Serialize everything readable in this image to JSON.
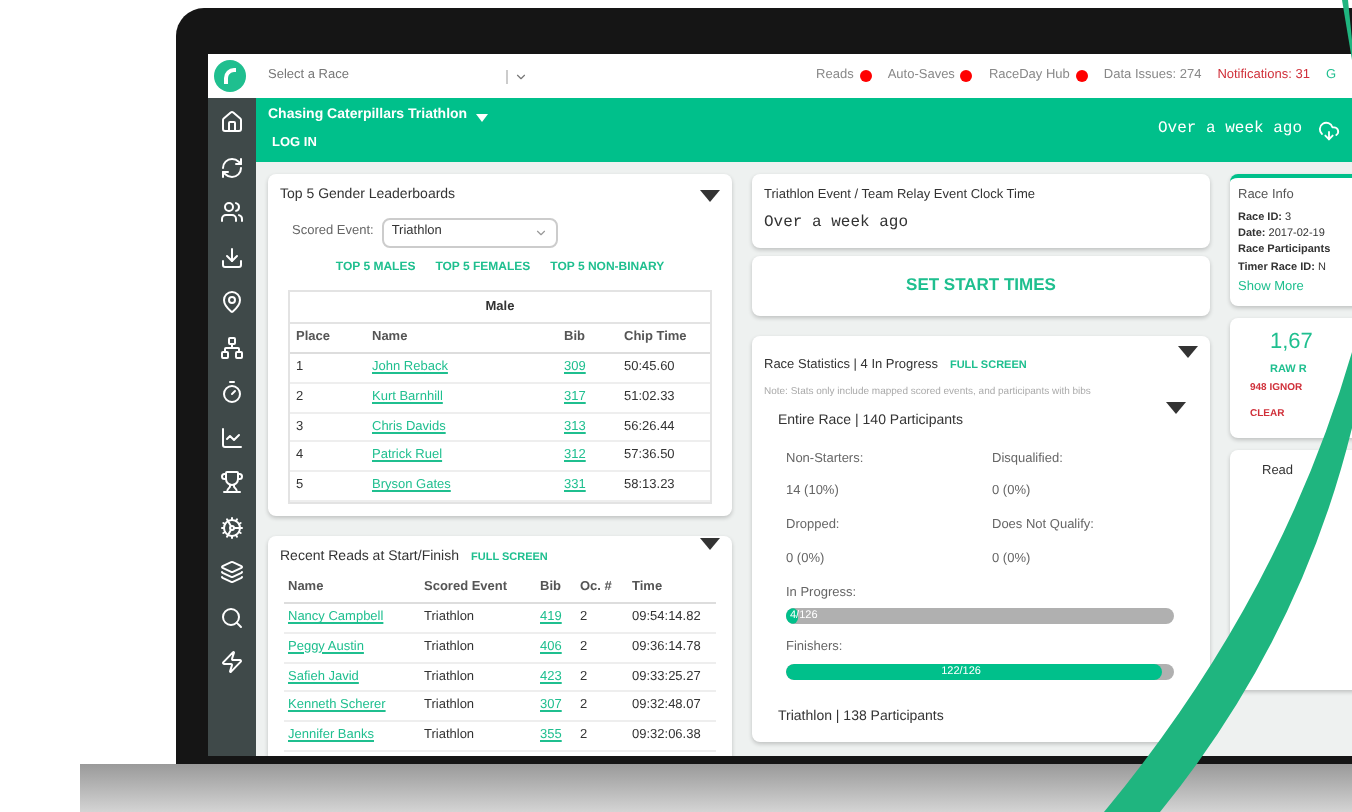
{
  "topbar": {
    "race_select": {
      "placeholder": "Select a Race"
    },
    "statuses": [
      {
        "label": "Reads",
        "color": "#ff0000"
      },
      {
        "label": "Auto-Saves",
        "color": "#ff0000"
      },
      {
        "label": "RaceDay Hub",
        "color": "#ff0000"
      }
    ],
    "data_issues": "Data Issues: 274",
    "notifications": "Notifications: 31",
    "cut_item": "G"
  },
  "header": {
    "race_name": "Chasing Caterpillars Triathlon",
    "login": "LOG IN",
    "updated": "Over a week ago"
  },
  "leaderboards": {
    "title": "Top 5 Gender Leaderboards",
    "scored_event_label": "Scored Event:",
    "scored_event": "Triathlon",
    "links": [
      "TOP 5 MALES",
      "TOP 5 FEMALES",
      "TOP 5 NON-BINARY"
    ],
    "table_title": "Male",
    "columns": [
      "Place",
      "Name",
      "Bib",
      "Chip Time"
    ],
    "rows": [
      [
        "1",
        "John Reback",
        "309",
        "50:45.60"
      ],
      [
        "2",
        "Kurt Barnhill",
        "317",
        "51:02.33"
      ],
      [
        "3",
        "Chris Davids",
        "313",
        "56:26.44"
      ],
      [
        "4",
        "Patrick Ruel",
        "312",
        "57:36.50"
      ],
      [
        "5",
        "Bryson Gates",
        "331",
        "58:13.23"
      ]
    ]
  },
  "recent_reads": {
    "title": "Recent Reads at Start/Finish",
    "full_screen": "FULL SCREEN",
    "columns": [
      "Name",
      "Scored Event",
      "Bib",
      "Oc. #",
      "Time"
    ],
    "rows": [
      [
        "Nancy Campbell",
        "Triathlon",
        "419",
        "2",
        "09:54:14.82"
      ],
      [
        "Peggy Austin",
        "Triathlon",
        "406",
        "2",
        "09:36:14.78"
      ],
      [
        "Safieh Javid",
        "Triathlon",
        "423",
        "2",
        "09:33:25.27"
      ],
      [
        "Kenneth Scherer",
        "Triathlon",
        "307",
        "2",
        "09:32:48.07"
      ],
      [
        "Jennifer Banks",
        "Triathlon",
        "355",
        "2",
        "09:32:06.38"
      ]
    ]
  },
  "clock": {
    "title": "Triathlon Event / Team Relay Event Clock Time",
    "value": "Over a week ago"
  },
  "set_start_times": "SET START TIMES",
  "race_stats": {
    "title": "Race Statistics | 4 In Progress",
    "full_screen": "FULL SCREEN",
    "note": "Note: Stats only include mapped scored events, and participants with bibs",
    "section": "Entire Race | 140 Participants",
    "stats": [
      {
        "label": "Non-Starters:",
        "value": "14 (10%)"
      },
      {
        "label": "Disqualified:",
        "value": "0 (0%)"
      },
      {
        "label": "Dropped:",
        "value": "0 (0%)"
      },
      {
        "label": "Does Not Qualify:",
        "value": "0 (0%)"
      }
    ],
    "bars": [
      {
        "label": "In Progress:",
        "reading": "4/126",
        "level": 0.032
      },
      {
        "label": "Finishers:",
        "reading": "122/126",
        "level": 0.968
      }
    ],
    "next_section": "Triathlon | 138 Participants"
  },
  "race_info": {
    "title": "Race Info",
    "lines": [
      {
        "key": "Race ID:",
        "value": "3"
      },
      {
        "key": "Date:",
        "value": "2017-02-19"
      },
      {
        "key": "Race Participants"
      },
      {
        "key": "Timer Race ID:",
        "value": "N"
      }
    ],
    "show_more": "Show More"
  },
  "raw_reads": {
    "count": "1,67",
    "label": "RAW R",
    "ignored": "948 IGNOR",
    "clear": "CLEAR"
  },
  "reads_card": {
    "title": "Read"
  }
}
